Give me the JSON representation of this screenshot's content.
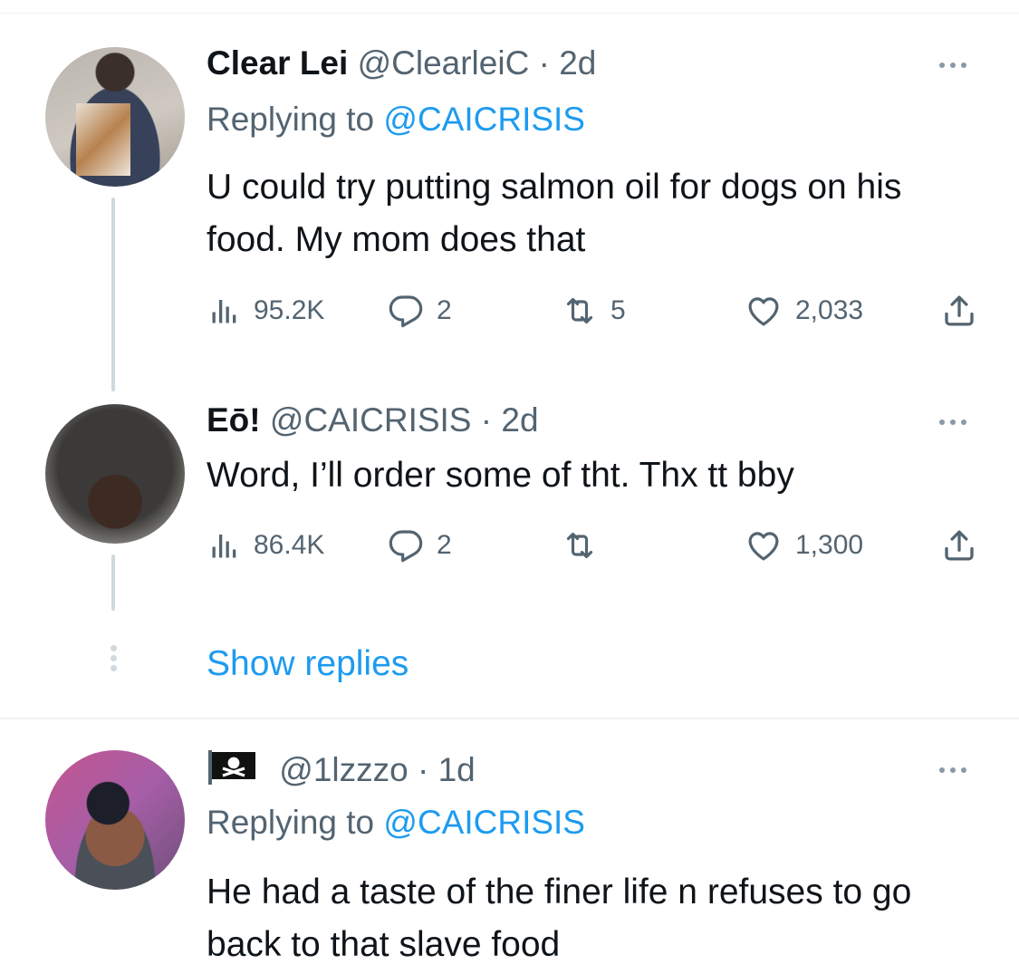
{
  "tweets": [
    {
      "name": "Clear Lei",
      "handle": "@ClearleiC",
      "separator": "·",
      "time": "2d",
      "replying_prefix": "Replying to",
      "replying_to": "@CAICRISIS",
      "text": "U could try putting salmon oil for dogs on his food. My mom does that",
      "views": "95.2K",
      "replies": "2",
      "retweets": "5",
      "likes": "2,033"
    },
    {
      "name": "Eō!",
      "handle": "@CAICRISIS",
      "separator": "·",
      "time": "2d",
      "text": "Word, I’ll order some of tht. Thx tt bby",
      "views": "86.4K",
      "replies": "2",
      "retweets": "",
      "likes": "1,300"
    },
    {
      "name": "",
      "handle": "@1lzzzo",
      "separator": "·",
      "time": "1d",
      "replying_prefix": "Replying to",
      "replying_to": "@CAICRISIS",
      "text": "He had a taste of the finer life n refuses to go back to that slave food"
    }
  ],
  "show_replies": "Show replies",
  "icons": {
    "views": "views-icon",
    "reply": "reply-icon",
    "retweet": "retweet-icon",
    "like": "heart-icon",
    "share": "share-icon",
    "more": "more-icon",
    "flag": "pirate-flag-icon"
  },
  "colors": {
    "accent": "#1d9bf0",
    "secondary_text": "#536471",
    "primary_text": "#0f1419",
    "thread_line": "#cfd9de"
  }
}
